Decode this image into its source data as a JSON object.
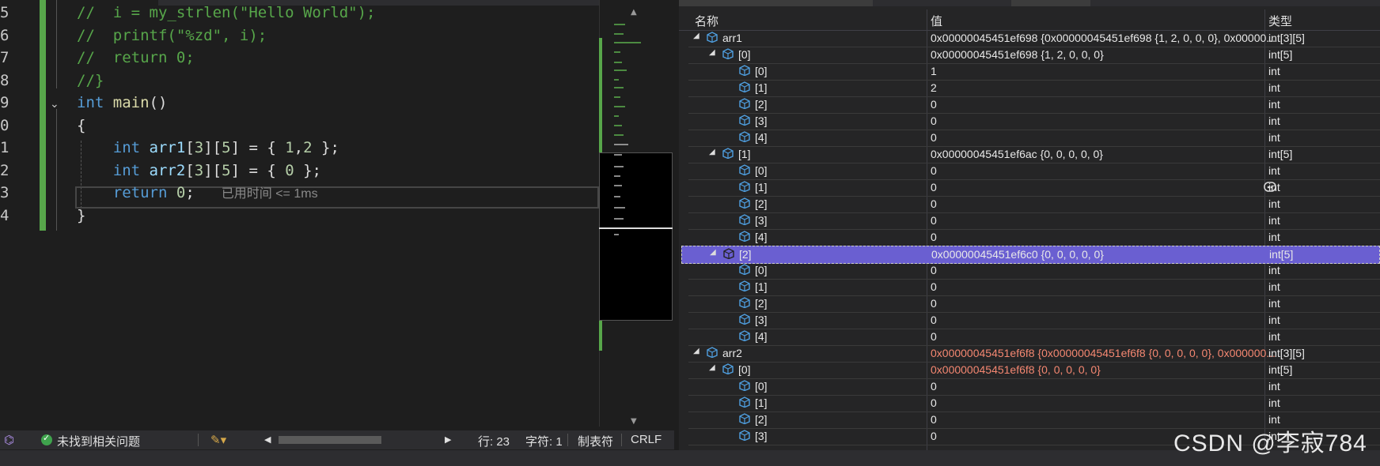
{
  "editor": {
    "line_numbers": [
      "5",
      "6",
      "7",
      "8",
      "9",
      "0",
      "1",
      "2",
      "3",
      "4"
    ],
    "lines": [
      {
        "tokens": [
          [
            "cmt",
            "//  i = my_strlen(\"Hello World\");"
          ]
        ]
      },
      {
        "tokens": [
          [
            "cmt",
            "//  printf(\"%zd\", i);"
          ]
        ]
      },
      {
        "tokens": [
          [
            "cmt",
            "//  return 0;"
          ]
        ]
      },
      {
        "tokens": [
          [
            "cmt",
            "//}"
          ]
        ]
      },
      {
        "tokens": [
          [
            "kw",
            "int"
          ],
          [
            "txt",
            " "
          ],
          [
            "fn",
            "main"
          ],
          [
            "txt",
            "()"
          ]
        ]
      },
      {
        "tokens": [
          [
            "txt",
            "{"
          ]
        ]
      },
      {
        "tokens": [
          [
            "txt",
            "    "
          ],
          [
            "kw",
            "int"
          ],
          [
            "txt",
            " "
          ],
          [
            "id",
            "arr1"
          ],
          [
            "txt",
            "["
          ],
          [
            "num",
            "3"
          ],
          [
            "txt",
            "]["
          ],
          [
            "num",
            "5"
          ],
          [
            "txt",
            "] = { "
          ],
          [
            "num",
            "1"
          ],
          [
            "txt",
            ","
          ],
          [
            "num",
            "2"
          ],
          [
            "txt",
            " };"
          ]
        ]
      },
      {
        "tokens": [
          [
            "txt",
            "    "
          ],
          [
            "kw",
            "int"
          ],
          [
            "txt",
            " "
          ],
          [
            "id",
            "arr2"
          ],
          [
            "txt",
            "["
          ],
          [
            "num",
            "3"
          ],
          [
            "txt",
            "]["
          ],
          [
            "num",
            "5"
          ],
          [
            "txt",
            "] = { "
          ],
          [
            "num",
            "0"
          ],
          [
            "txt",
            " };"
          ]
        ]
      },
      {
        "tokens": [
          [
            "txt",
            "    "
          ],
          [
            "kw",
            "return"
          ],
          [
            "txt",
            " "
          ],
          [
            "num",
            "0"
          ],
          [
            "txt",
            ";"
          ]
        ]
      },
      {
        "tokens": [
          [
            "txt",
            "}"
          ]
        ]
      }
    ],
    "perf_tip": "已用时间 <= 1ms"
  },
  "status": {
    "issues": "未找到相关问题",
    "line": "行: 23",
    "char": "字符: 1",
    "tab": "制表符",
    "eol": "CRLF"
  },
  "watch": {
    "col_name": "名称",
    "col_value": "值",
    "col_type": "类型",
    "rows": [
      {
        "level": 0,
        "tri": "◢",
        "name": "arr1",
        "value": "0x00000045451ef698 {0x00000045451ef698 {1, 2, 0, 0, 0}, 0x00000...",
        "type": "int[3][5]"
      },
      {
        "level": 1,
        "tri": "◢",
        "name": "[0]",
        "value": "0x00000045451ef698 {1, 2, 0, 0, 0}",
        "type": "int[5]"
      },
      {
        "level": 2,
        "name": "[0]",
        "value": "1",
        "type": "int"
      },
      {
        "level": 2,
        "name": "[1]",
        "value": "2",
        "type": "int"
      },
      {
        "level": 2,
        "name": "[2]",
        "value": "0",
        "type": "int"
      },
      {
        "level": 2,
        "name": "[3]",
        "value": "0",
        "type": "int"
      },
      {
        "level": 2,
        "name": "[4]",
        "value": "0",
        "type": "int"
      },
      {
        "level": 1,
        "tri": "◢",
        "name": "[1]",
        "value": "0x00000045451ef6ac {0, 0, 0, 0, 0}",
        "type": "int[5]"
      },
      {
        "level": 2,
        "name": "[0]",
        "value": "0",
        "type": "int"
      },
      {
        "level": 2,
        "name": "[1]",
        "value": "0",
        "type": "int"
      },
      {
        "level": 2,
        "name": "[2]",
        "value": "0",
        "type": "int"
      },
      {
        "level": 2,
        "name": "[3]",
        "value": "0",
        "type": "int"
      },
      {
        "level": 2,
        "name": "[4]",
        "value": "0",
        "type": "int"
      },
      {
        "level": 1,
        "tri": "◢",
        "name": "[2]",
        "value": "0x00000045451ef6c0 {0, 0, 0, 0, 0}",
        "type": "int[5]",
        "selected": true
      },
      {
        "level": 2,
        "name": "[0]",
        "value": "0",
        "type": "int"
      },
      {
        "level": 2,
        "name": "[1]",
        "value": "0",
        "type": "int"
      },
      {
        "level": 2,
        "name": "[2]",
        "value": "0",
        "type": "int"
      },
      {
        "level": 2,
        "name": "[3]",
        "value": "0",
        "type": "int"
      },
      {
        "level": 2,
        "name": "[4]",
        "value": "0",
        "type": "int"
      },
      {
        "level": 0,
        "tri": "◢",
        "name": "arr2",
        "value": "0x00000045451ef6f8 {0x00000045451ef6f8 {0, 0, 0, 0, 0}, 0x000000...",
        "type": "int[3][5]",
        "changed": true
      },
      {
        "level": 1,
        "tri": "◢",
        "name": "[0]",
        "value": "0x00000045451ef6f8 {0, 0, 0, 0, 0}",
        "type": "int[5]",
        "changed": true
      },
      {
        "level": 2,
        "name": "[0]",
        "value": "0",
        "type": "int"
      },
      {
        "level": 2,
        "name": "[1]",
        "value": "0",
        "type": "int"
      },
      {
        "level": 2,
        "name": "[2]",
        "value": "0",
        "type": "int"
      },
      {
        "level": 2,
        "name": "[3]",
        "value": "0",
        "type": "int"
      }
    ]
  },
  "watermark": "CSDN @李寂784"
}
